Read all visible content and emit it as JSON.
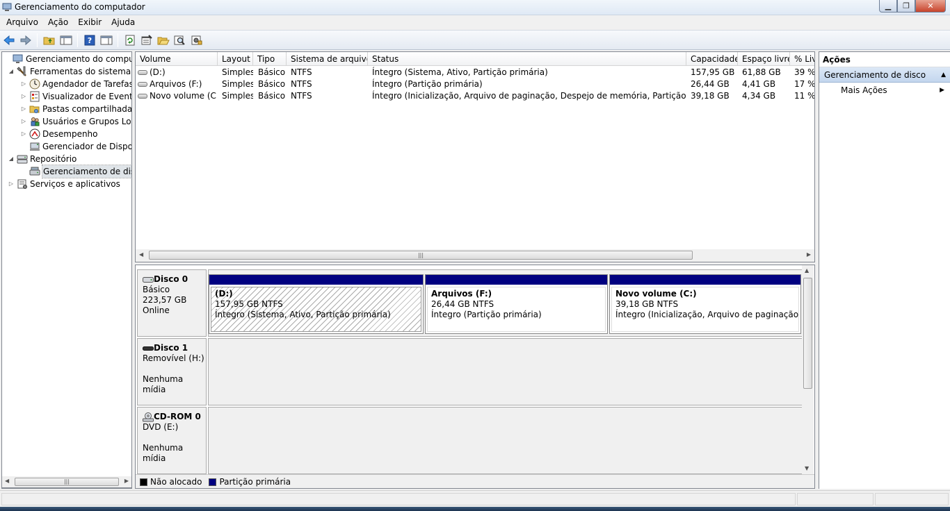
{
  "window": {
    "title": "Gerenciamento do computador"
  },
  "menu": [
    "Arquivo",
    "Ação",
    "Exibir",
    "Ajuda"
  ],
  "toolbar": {
    "buttons": [
      "back-icon",
      "forward-icon",
      "up-folder-icon",
      "show-hide-tree-icon",
      "help-icon",
      "show-hide-action-pane-icon",
      "refresh-icon",
      "properties-icon",
      "open-icon",
      "search-icon",
      "settings-icon"
    ]
  },
  "tree": {
    "items": [
      {
        "label": "Gerenciamento do computador",
        "level": 0,
        "expander": "",
        "icon": "computer-management-icon"
      },
      {
        "label": "Ferramentas do sistema",
        "level": 1,
        "expander": "◢",
        "icon": "tools-icon"
      },
      {
        "label": "Agendador de Tarefas",
        "level": 2,
        "expander": "▷",
        "icon": "clock-icon"
      },
      {
        "label": "Visualizador de Eventos",
        "level": 2,
        "expander": "▷",
        "icon": "event-viewer-icon"
      },
      {
        "label": "Pastas compartilhadas",
        "level": 2,
        "expander": "▷",
        "icon": "shared-folder-icon"
      },
      {
        "label": "Usuários e Grupos Loca",
        "level": 2,
        "expander": "▷",
        "icon": "users-icon"
      },
      {
        "label": "Desempenho",
        "level": 2,
        "expander": "▷",
        "icon": "performance-icon"
      },
      {
        "label": "Gerenciador de Disposit",
        "level": 2,
        "expander": "",
        "icon": "device-manager-icon"
      },
      {
        "label": "Repositório",
        "level": 1,
        "expander": "◢",
        "icon": "storage-icon"
      },
      {
        "label": "Gerenciamento de disco",
        "level": 2,
        "expander": "",
        "icon": "disk-management-icon",
        "selected": true
      },
      {
        "label": "Serviços e aplicativos",
        "level": 1,
        "expander": "▷",
        "icon": "services-icon"
      }
    ]
  },
  "volumes": {
    "columns": [
      "Volume",
      "Layout",
      "Tipo",
      "Sistema de arquivos",
      "Status",
      "Capacidade",
      "Espaço livre",
      "% Livre"
    ],
    "rows": [
      [
        "(D:)",
        "Simples",
        "Básico",
        "NTFS",
        "Íntegro (Sistema, Ativo, Partição primária)",
        "157,95 GB",
        "61,88 GB",
        "39 %"
      ],
      [
        "Arquivos (F:)",
        "Simples",
        "Básico",
        "NTFS",
        "Íntegro (Partição primária)",
        "26,44 GB",
        "4,41 GB",
        "17 %"
      ],
      [
        "Novo volume (C:)",
        "Simples",
        "Básico",
        "NTFS",
        "Íntegro (Inicialização, Arquivo de paginação, Despejo de memória, Partição primária)",
        "39,18 GB",
        "4,34 GB",
        "11 %"
      ]
    ]
  },
  "disks": [
    {
      "name": "Disco 0",
      "line1": "Básico",
      "line2": "223,57 GB",
      "line3": "Online",
      "partitions": [
        {
          "name": "(D:)",
          "size": "157,95 GB NTFS",
          "status": "Íntegro (Sistema, Ativo, Partição primária)",
          "selected": true
        },
        {
          "name": "Arquivos  (F:)",
          "size": "26,44 GB NTFS",
          "status": "Íntegro (Partição primária)"
        },
        {
          "name": "Novo volume  (C:)",
          "size": "39,18 GB NTFS",
          "status": "Íntegro (Inicialização, Arquivo de paginação, Desp"
        }
      ]
    },
    {
      "name": "Disco 1",
      "line1": "Removível (H:)",
      "line2": "",
      "line3": "Nenhuma mídia"
    },
    {
      "name": "CD-ROM 0",
      "line1": "DVD (E:)",
      "line2": "",
      "line3": "Nenhuma mídia"
    }
  ],
  "legend": [
    {
      "label": "Não alocado",
      "color": "#000000"
    },
    {
      "label": "Partição primária",
      "color": "#000080"
    }
  ],
  "actions": {
    "header": "Ações",
    "section": "Gerenciamento de disco",
    "items": [
      "Mais Ações"
    ]
  },
  "colors": {
    "primary_partition": "#000080",
    "unallocated": "#000000",
    "selection": "#c3d6ee"
  }
}
